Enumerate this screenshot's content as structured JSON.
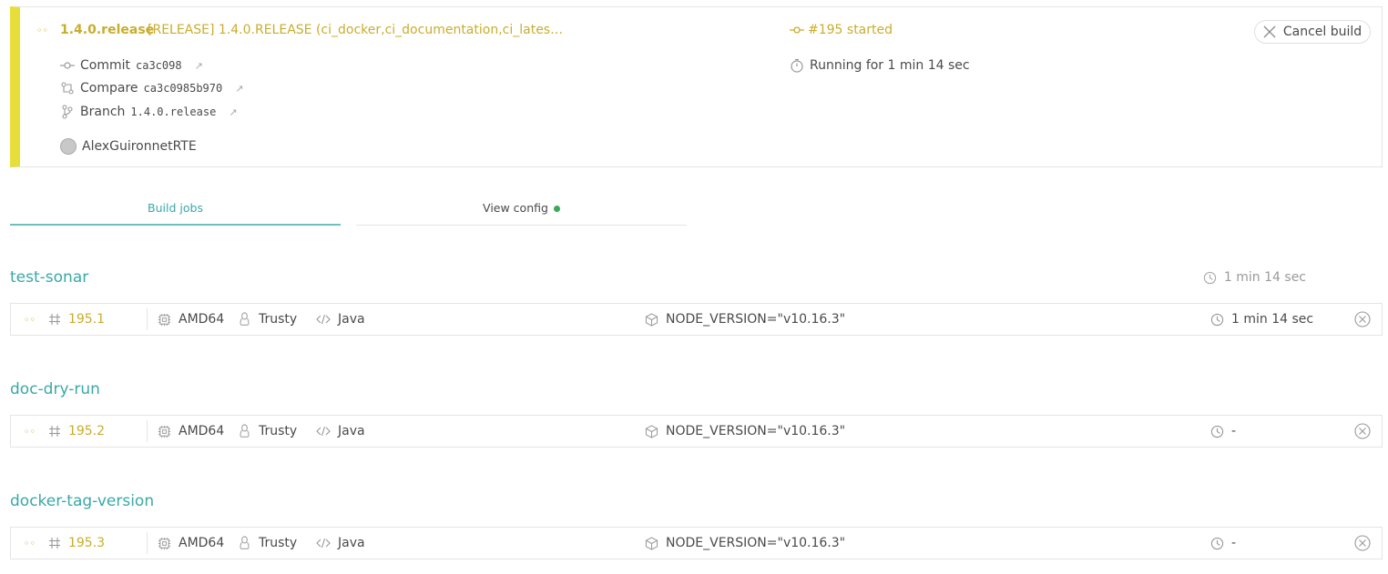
{
  "build": {
    "branch": "1.4.0.release",
    "commit_message": "[RELEASE] 1.4.0.RELEASE (ci_docker,ci_documentation,ci_lates…",
    "status": "#195 started",
    "running_for": "Running for 1 min 14 sec",
    "commit_label": "Commit",
    "commit_sha": "ca3c098",
    "compare_label": "Compare",
    "compare_range": "ca3c0985b970",
    "branch_label": "Branch",
    "branch_ref": "1.4.0.release",
    "author": "AlexGuironnetRTE",
    "cancel_label": "Cancel build",
    "accent_color": "#e8de3a"
  },
  "tabs": {
    "build_jobs": "Build jobs",
    "view_config": "View config"
  },
  "stages": [
    {
      "name": "test-sonar",
      "duration": "1 min 14 sec",
      "jobs": [
        {
          "number": "195.1",
          "arch": "AMD64",
          "os": "Trusty",
          "language": "Java",
          "env": "NODE_VERSION=\"v10.16.3\"",
          "duration": "1 min 14 sec"
        }
      ]
    },
    {
      "name": "doc-dry-run",
      "duration": "",
      "jobs": [
        {
          "number": "195.2",
          "arch": "AMD64",
          "os": "Trusty",
          "language": "Java",
          "env": "NODE_VERSION=\"v10.16.3\"",
          "duration": "-"
        }
      ]
    },
    {
      "name": "docker-tag-version",
      "duration": "",
      "jobs": [
        {
          "number": "195.3",
          "arch": "AMD64",
          "os": "Trusty",
          "language": "Java",
          "env": "NODE_VERSION=\"v10.16.3\"",
          "duration": "-"
        }
      ]
    }
  ],
  "icons": {
    "started": "dots-icon",
    "commit": "commit-icon",
    "compare": "compare-icon",
    "branch": "branch-icon",
    "external": "external-link-icon",
    "timer": "stopwatch-icon",
    "cancel": "close-icon",
    "hash": "hash-icon",
    "cpu": "cpu-icon",
    "linux": "linux-icon",
    "code": "code-icon",
    "env": "package-icon",
    "clock": "clock-icon",
    "job_cancel": "circle-close-icon"
  }
}
